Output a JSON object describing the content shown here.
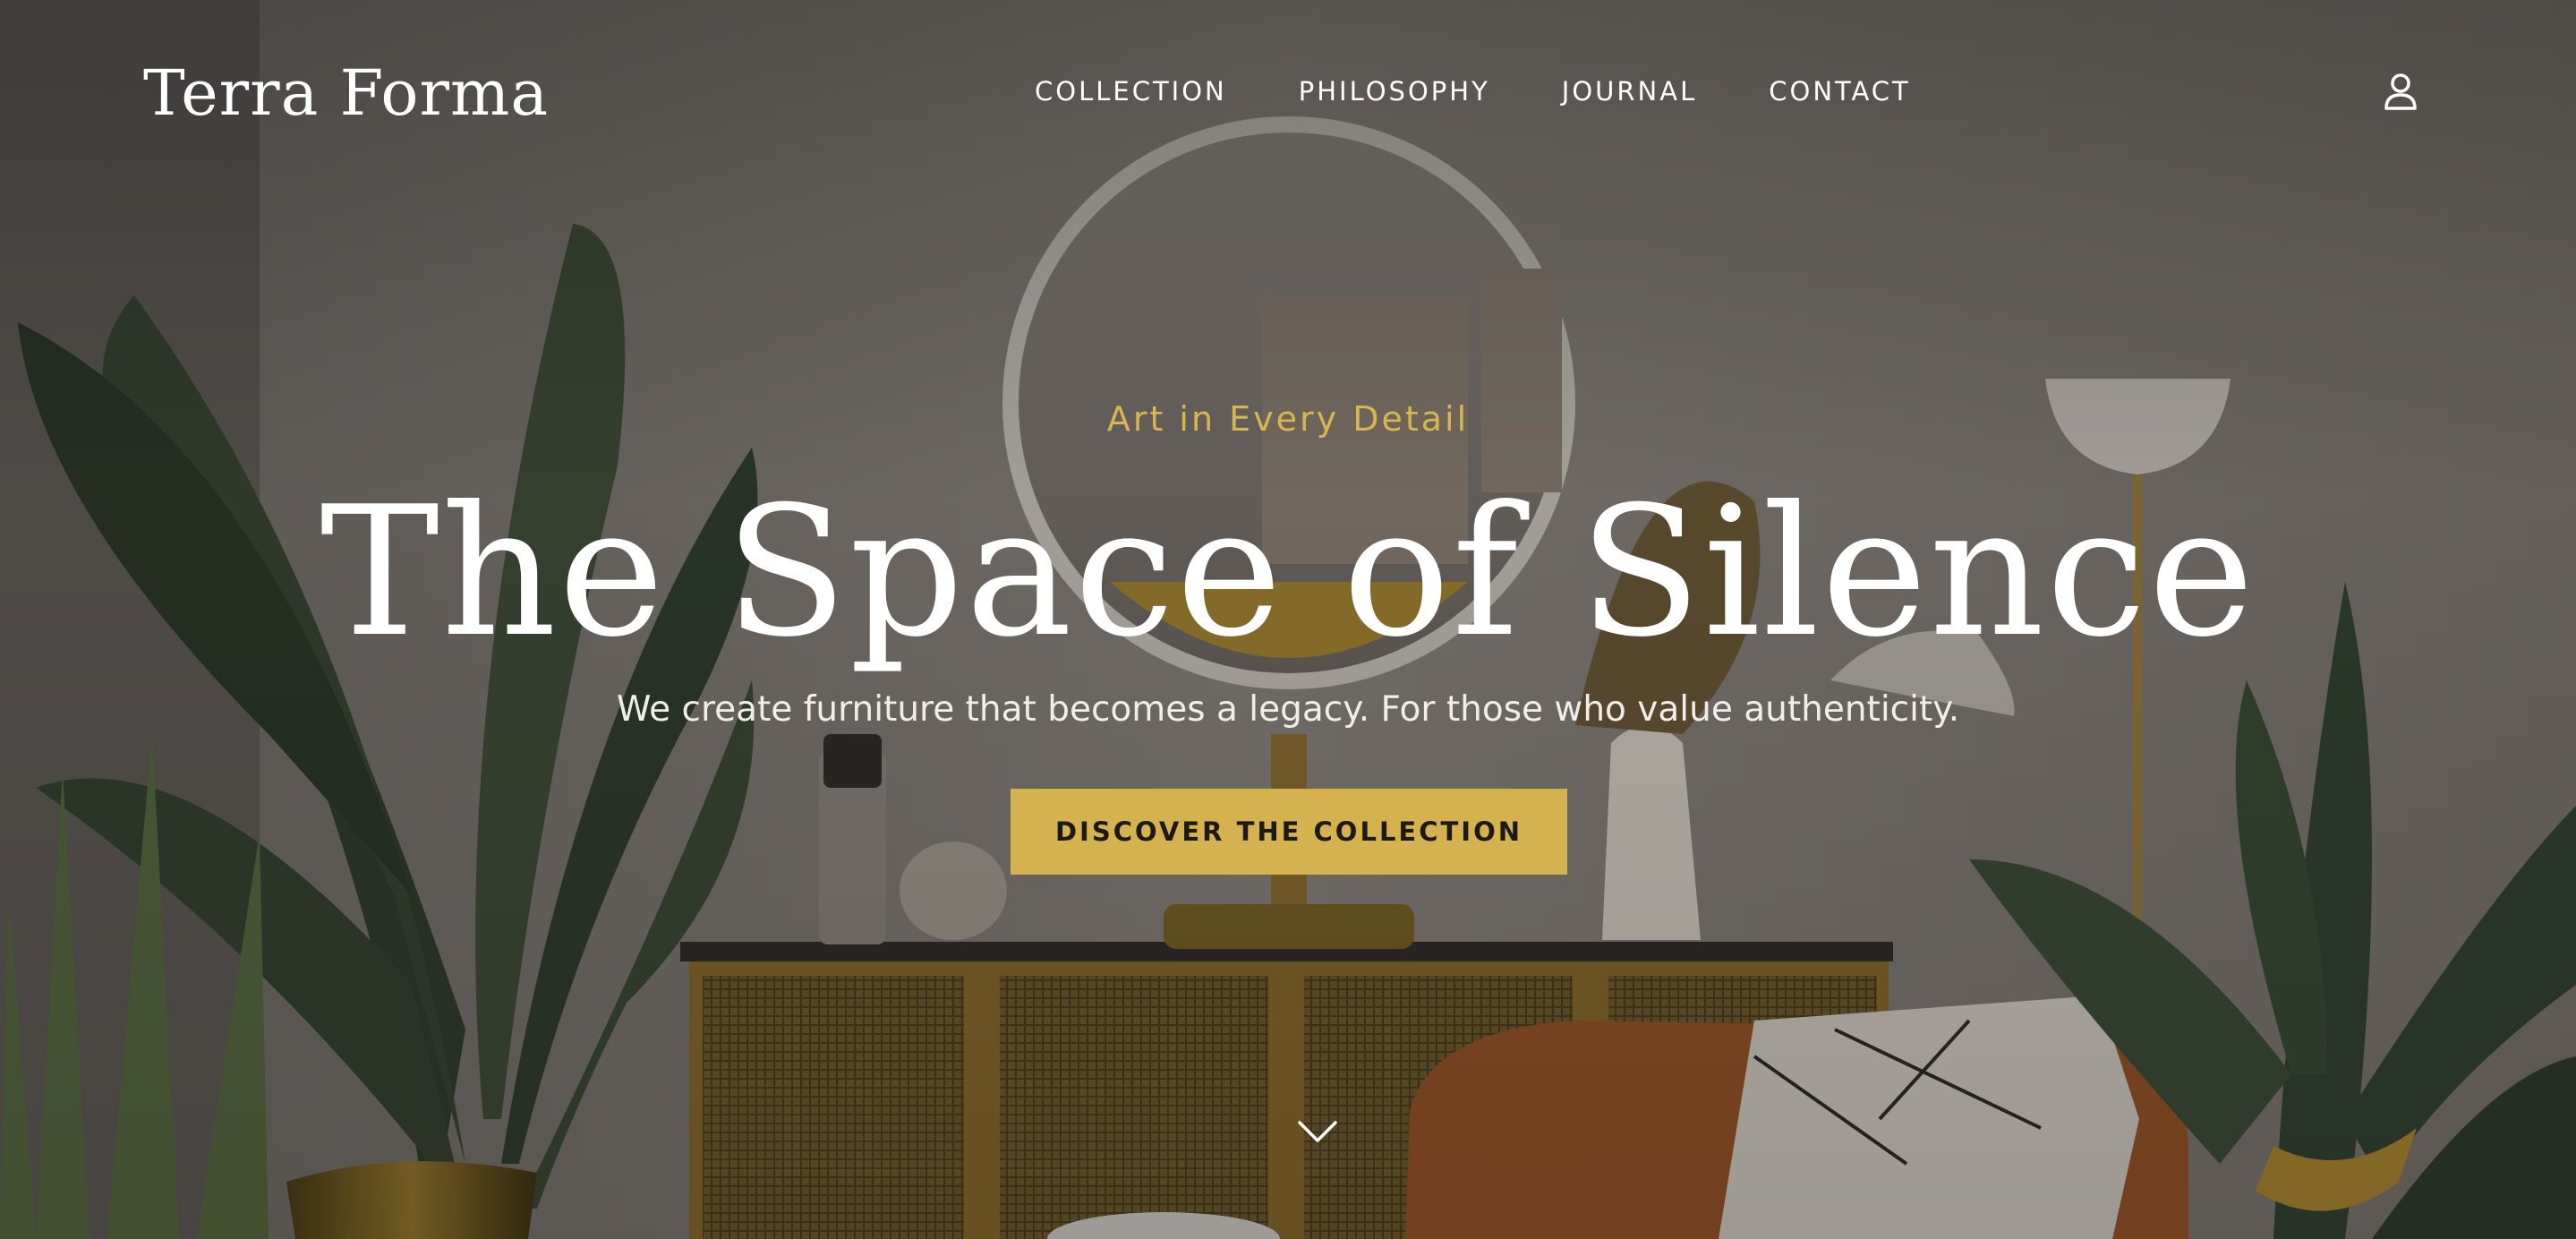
{
  "brand": {
    "logo": "Terra Forma"
  },
  "nav": {
    "items": [
      {
        "label": "COLLECTION"
      },
      {
        "label": "PHILOSOPHY"
      },
      {
        "label": "JOURNAL"
      },
      {
        "label": "CONTACT"
      }
    ]
  },
  "header": {
    "account_icon": "user-icon"
  },
  "hero": {
    "eyebrow": "Art in Every Detail",
    "title": "The Space of Silence",
    "subtitle": "We create furniture that becomes a legacy. For those who value authenticity.",
    "cta_label": "DISCOVER THE COLLECTION",
    "scroll_icon": "chevron-down-icon"
  },
  "colors": {
    "accent": "#d3b24f",
    "eyebrow": "#d7b650",
    "text": "#ffffff"
  }
}
